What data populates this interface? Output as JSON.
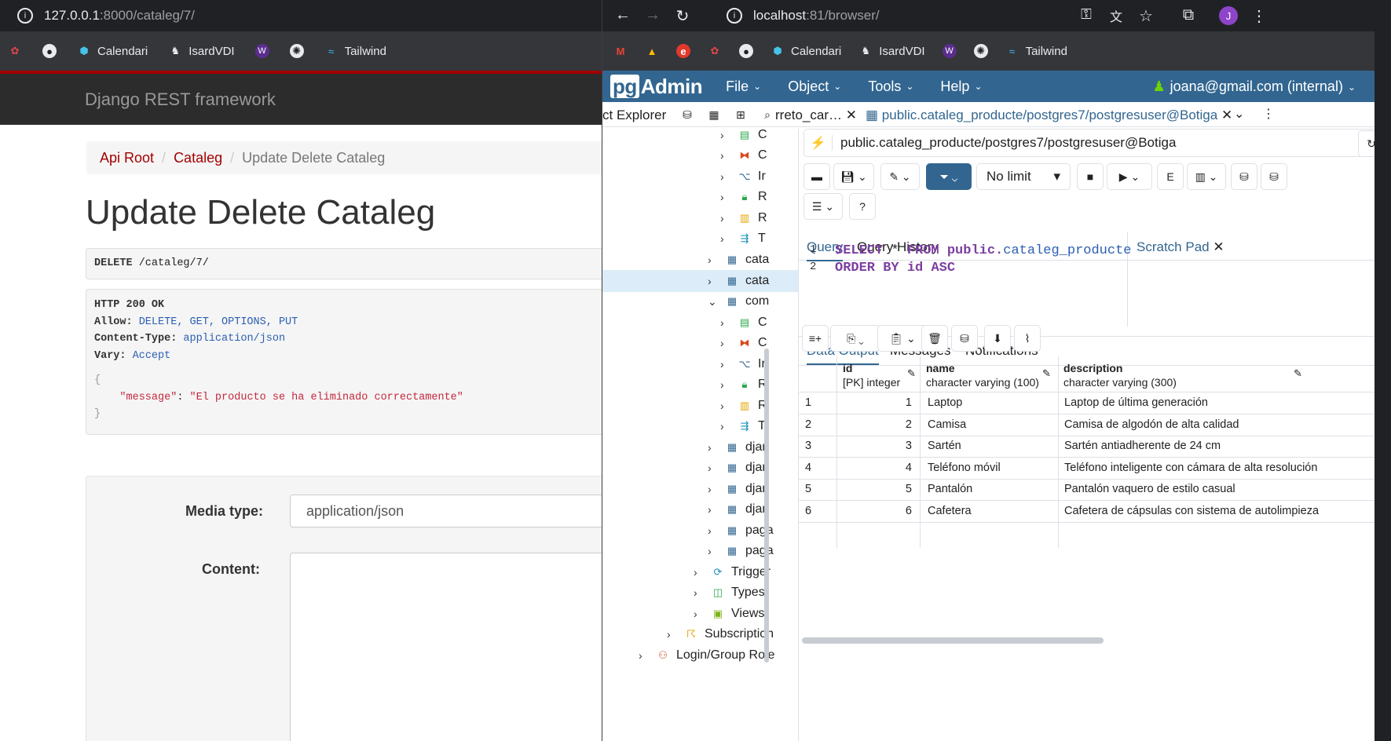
{
  "left": {
    "url_host": "127.0.0.1",
    "url_rest": ":8000/cataleg/7/",
    "bookmarks": [
      "Calendari",
      "IsardVDI",
      "Tailwind"
    ],
    "brand": "Django REST framework",
    "breadcrumb": {
      "root": "Api Root",
      "mid": "Cataleg",
      "active": "Update Delete Cataleg"
    },
    "title": "Update Delete Cataleg",
    "request": {
      "method": "DELETE",
      "path": " /cataleg/7/"
    },
    "response": {
      "status": "HTTP 200 OK",
      "allow_key": "Allow:",
      "allow_val": " DELETE, GET, OPTIONS, PUT",
      "ct_key": "Content-Type:",
      "ct_val": " application/json",
      "vary_key": "Vary:",
      "vary_val": " Accept",
      "brace_open": "{",
      "msg_key": "    \"message\"",
      "msg_colon": ": ",
      "msg_val": "\"El producto se ha eliminado correctamente\"",
      "brace_close": "}"
    },
    "form": {
      "media_label": "Media type:",
      "media_value": "application/json",
      "content_label": "Content:"
    }
  },
  "right": {
    "url_host": "localhost",
    "url_rest": ":81/browser/",
    "bookmarks": [
      "Calendari",
      "IsardVDI",
      "Tailwind"
    ],
    "avatar_letter": "J",
    "pgadmin": {
      "logo_pg": "pg",
      "logo_admin": "Admin",
      "menus": [
        "File",
        "Object",
        "Tools",
        "Help"
      ],
      "user": "joana@gmail.com (internal)"
    },
    "tabs": {
      "explorer": "ct Explorer",
      "tab1": "rreto_car…",
      "tab2": "public.cataleg_producte/postgres7/postgresuser@Botiga"
    },
    "connection": "public.cataleg_producte/postgres7/postgresuser@Botiga",
    "limit": "No limit",
    "query_tabs": {
      "query": "Query",
      "history": "Query History",
      "scratch": "Scratch Pad"
    },
    "sql": {
      "l1_num": "1",
      "l1_kw1": "SELECT",
      "l1_star": " * ",
      "l1_kw2": "FROM",
      "l1_schema": " public.",
      "l1_table": "cataleg_producte",
      "l2_num": "2",
      "l2_kw1": "ORDER BY",
      "l2_id": " id ",
      "l2_kw2": "ASC"
    },
    "data_tabs": {
      "output": "Data Output",
      "messages": "Messages",
      "notifications": "Notifications"
    },
    "tree": {
      "c1": "C",
      "c2": "C",
      "c3": "Ir",
      "c4": "R",
      "c5": "R",
      "c6": "T",
      "cata1": "cata",
      "cata2": "cata",
      "com": "com",
      "d1": "C",
      "d2": "C",
      "d3": "Ir",
      "d4": "R",
      "d5": "R",
      "d6": "T",
      "djan1": "djan",
      "djan2": "djan",
      "djan3": "djan",
      "djan4": "djan",
      "paga1": "paga",
      "paga2": "paga",
      "triggers": "Trigger",
      "types": "Types",
      "views": "Views",
      "subs": "Subscription",
      "roles": "Login/Group Role"
    },
    "table": {
      "columns": [
        {
          "name": "id",
          "type": "[PK] integer"
        },
        {
          "name": "name",
          "type": "character varying (100)"
        },
        {
          "name": "description",
          "type": "character varying (300)"
        }
      ],
      "rows": [
        {
          "n": "1",
          "id": "1",
          "name": "Laptop",
          "desc": "Laptop de última generación"
        },
        {
          "n": "2",
          "id": "2",
          "name": "Camisa",
          "desc": "Camisa de algodón de alta calidad"
        },
        {
          "n": "3",
          "id": "3",
          "name": "Sartén",
          "desc": "Sartén antiadherente de 24 cm"
        },
        {
          "n": "4",
          "id": "4",
          "name": "Teléfono móvil",
          "desc": "Teléfono inteligente con cámara de alta resolución"
        },
        {
          "n": "5",
          "id": "5",
          "name": "Pantalón",
          "desc": "Pantalón vaquero de estilo casual"
        },
        {
          "n": "6",
          "id": "6",
          "name": "Cafetera",
          "desc": "Cafetera de cápsulas con sistema de autolimpieza"
        }
      ]
    }
  },
  "colors": {
    "drf_red": "#a30000",
    "pg_blue": "#326690",
    "chrome_dark": "#202124"
  }
}
